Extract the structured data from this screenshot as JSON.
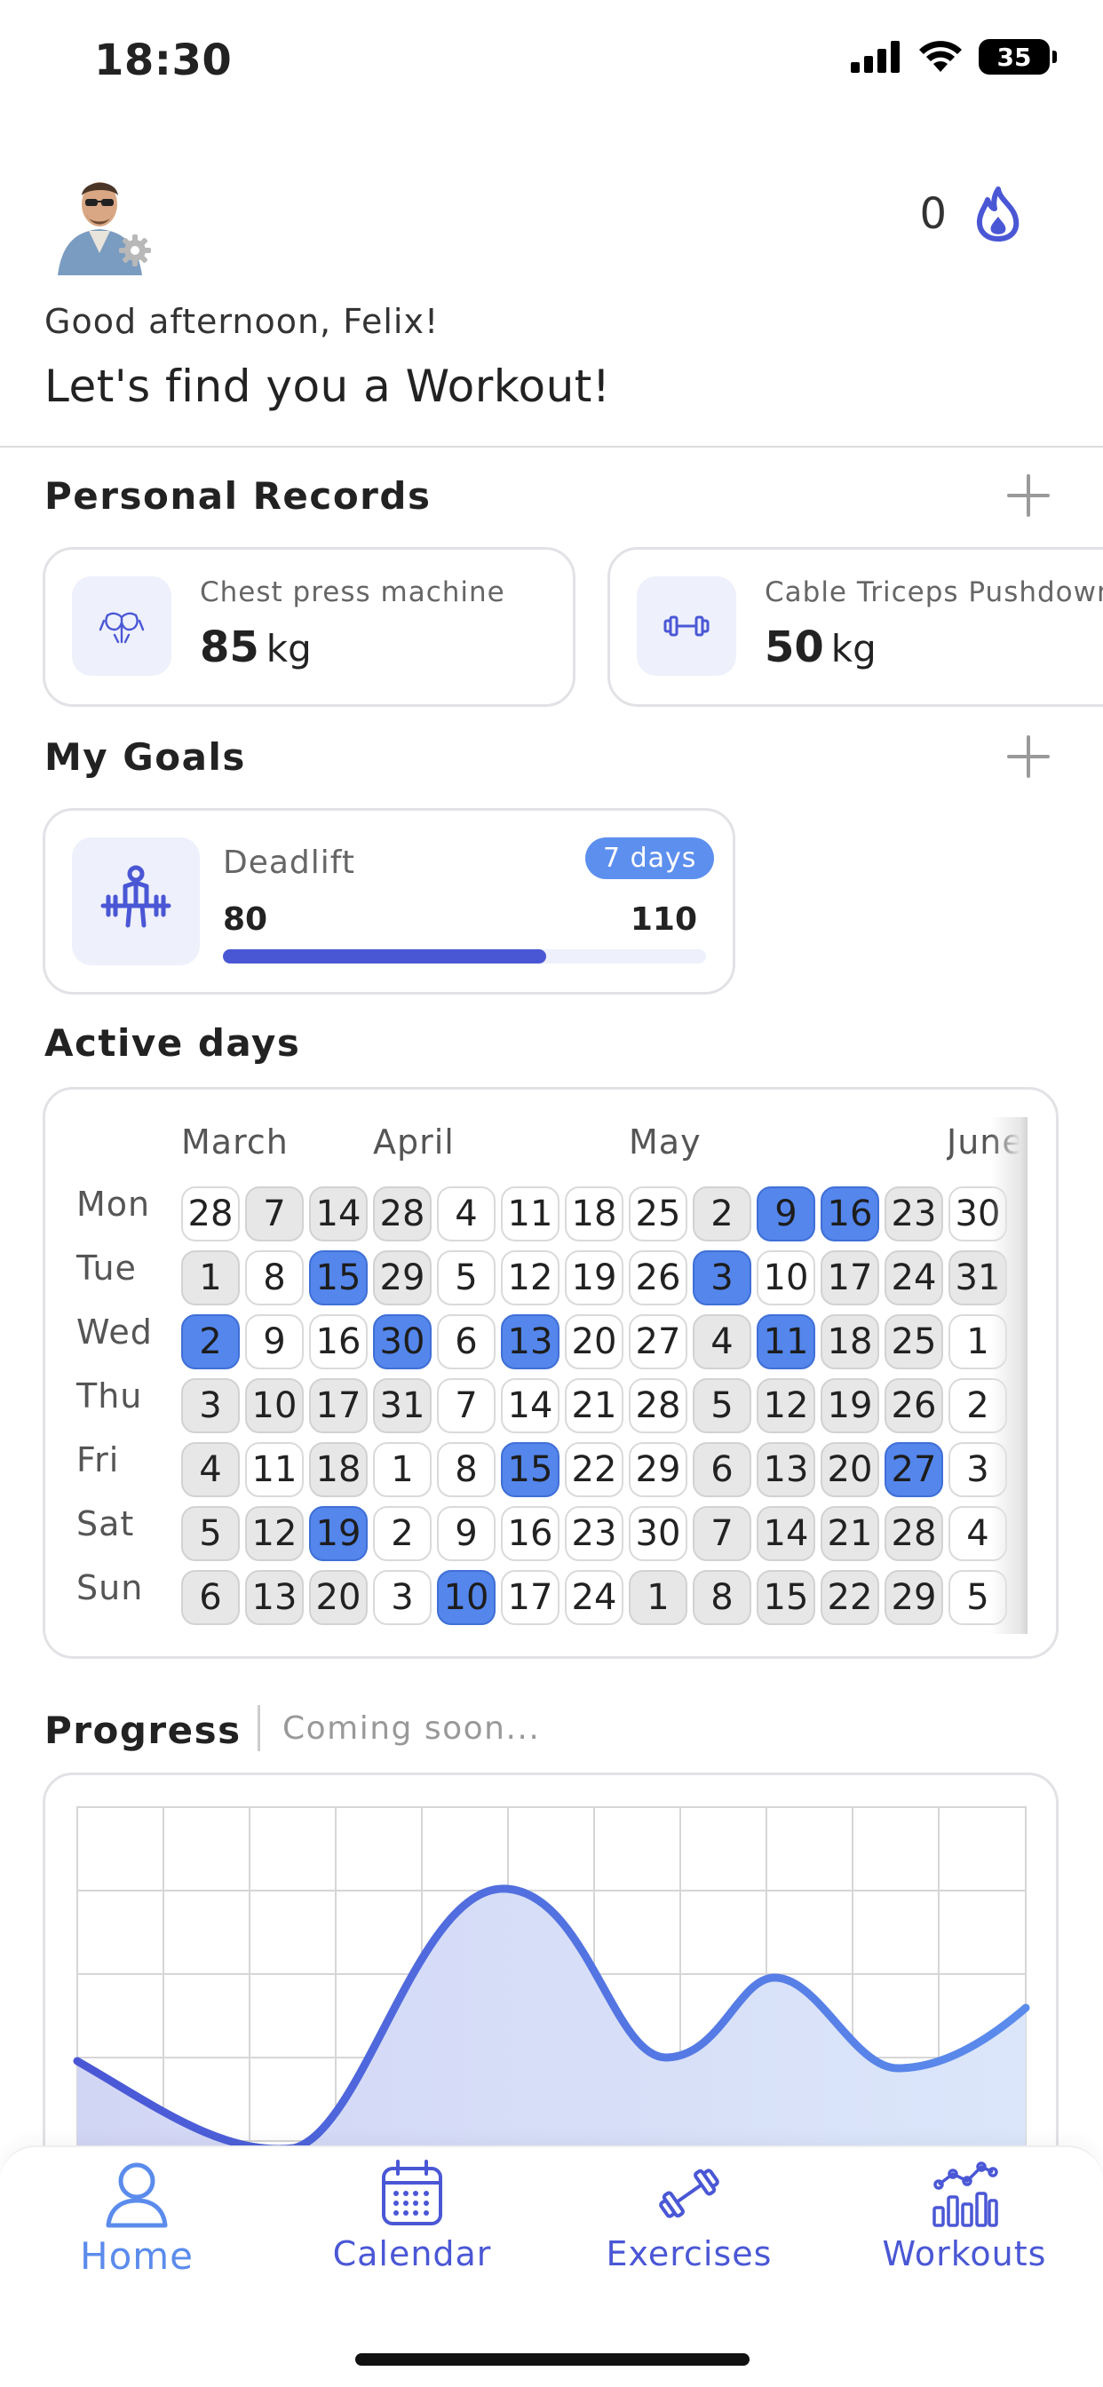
{
  "status": {
    "time": "18:30",
    "battery": "35"
  },
  "header": {
    "streak_count": "0",
    "greeting": "Good afternoon, Felix!",
    "headline": "Let's find you a Workout!"
  },
  "personal_records": {
    "title": "Personal Records",
    "items": [
      {
        "name": "Chest press machine",
        "value": "85",
        "unit": "kg",
        "icon": "chest-muscle-icon"
      },
      {
        "name": "Cable Triceps Pushdown",
        "value": "50",
        "unit": "kg",
        "icon": "dumbbell-icon"
      }
    ]
  },
  "goals": {
    "title": "My Goals",
    "items": [
      {
        "name": "Deadlift",
        "badge": "7 days",
        "start": "80",
        "target": "110",
        "progress": 0.67,
        "icon": "barbell-lift-icon"
      }
    ]
  },
  "active_days": {
    "title": "Active days",
    "months": [
      "March",
      "April",
      "May",
      "June"
    ],
    "weekdays": [
      "Mon",
      "Tue",
      "Wed",
      "Thu",
      "Fri",
      "Sat",
      "Sun"
    ],
    "weeks": [
      [
        {
          "d": "28",
          "s": "white"
        },
        {
          "d": "1",
          "s": "gray"
        },
        {
          "d": "2",
          "s": "blue"
        },
        {
          "d": "3",
          "s": "gray"
        },
        {
          "d": "4",
          "s": "gray"
        },
        {
          "d": "5",
          "s": "gray"
        },
        {
          "d": "6",
          "s": "gray"
        }
      ],
      [
        {
          "d": "7",
          "s": "gray"
        },
        {
          "d": "8",
          "s": "white"
        },
        {
          "d": "9",
          "s": "white"
        },
        {
          "d": "10",
          "s": "gray"
        },
        {
          "d": "11",
          "s": "white"
        },
        {
          "d": "12",
          "s": "gray"
        },
        {
          "d": "13",
          "s": "gray"
        }
      ],
      [
        {
          "d": "14",
          "s": "gray"
        },
        {
          "d": "15",
          "s": "blue"
        },
        {
          "d": "16",
          "s": "white"
        },
        {
          "d": "17",
          "s": "gray"
        },
        {
          "d": "18",
          "s": "gray"
        },
        {
          "d": "19",
          "s": "blue"
        },
        {
          "d": "20",
          "s": "gray"
        }
      ],
      [
        {
          "d": "28",
          "s": "gray"
        },
        {
          "d": "29",
          "s": "gray"
        },
        {
          "d": "30",
          "s": "blue"
        },
        {
          "d": "31",
          "s": "gray"
        },
        {
          "d": "1",
          "s": "white"
        },
        {
          "d": "2",
          "s": "white"
        },
        {
          "d": "3",
          "s": "white"
        }
      ],
      [
        {
          "d": "4",
          "s": "white"
        },
        {
          "d": "5",
          "s": "white"
        },
        {
          "d": "6",
          "s": "white"
        },
        {
          "d": "7",
          "s": "white"
        },
        {
          "d": "8",
          "s": "white"
        },
        {
          "d": "9",
          "s": "white"
        },
        {
          "d": "10",
          "s": "blue"
        }
      ],
      [
        {
          "d": "11",
          "s": "white"
        },
        {
          "d": "12",
          "s": "white"
        },
        {
          "d": "13",
          "s": "blue"
        },
        {
          "d": "14",
          "s": "white"
        },
        {
          "d": "15",
          "s": "blue"
        },
        {
          "d": "16",
          "s": "white"
        },
        {
          "d": "17",
          "s": "white"
        }
      ],
      [
        {
          "d": "18",
          "s": "white"
        },
        {
          "d": "19",
          "s": "white"
        },
        {
          "d": "20",
          "s": "white"
        },
        {
          "d": "21",
          "s": "white"
        },
        {
          "d": "22",
          "s": "white"
        },
        {
          "d": "23",
          "s": "white"
        },
        {
          "d": "24",
          "s": "white"
        }
      ],
      [
        {
          "d": "25",
          "s": "white"
        },
        {
          "d": "26",
          "s": "white"
        },
        {
          "d": "27",
          "s": "white"
        },
        {
          "d": "28",
          "s": "white"
        },
        {
          "d": "29",
          "s": "white"
        },
        {
          "d": "30",
          "s": "white"
        },
        {
          "d": "1",
          "s": "gray"
        }
      ],
      [
        {
          "d": "2",
          "s": "gray"
        },
        {
          "d": "3",
          "s": "blue"
        },
        {
          "d": "4",
          "s": "gray"
        },
        {
          "d": "5",
          "s": "gray"
        },
        {
          "d": "6",
          "s": "gray"
        },
        {
          "d": "7",
          "s": "gray"
        },
        {
          "d": "8",
          "s": "gray"
        }
      ],
      [
        {
          "d": "9",
          "s": "blue"
        },
        {
          "d": "10",
          "s": "white"
        },
        {
          "d": "11",
          "s": "blue"
        },
        {
          "d": "12",
          "s": "gray"
        },
        {
          "d": "13",
          "s": "gray"
        },
        {
          "d": "14",
          "s": "gray"
        },
        {
          "d": "15",
          "s": "gray"
        }
      ],
      [
        {
          "d": "16",
          "s": "blue"
        },
        {
          "d": "17",
          "s": "gray"
        },
        {
          "d": "18",
          "s": "gray"
        },
        {
          "d": "19",
          "s": "gray"
        },
        {
          "d": "20",
          "s": "gray"
        },
        {
          "d": "21",
          "s": "gray"
        },
        {
          "d": "22",
          "s": "gray"
        }
      ],
      [
        {
          "d": "23",
          "s": "gray"
        },
        {
          "d": "24",
          "s": "gray"
        },
        {
          "d": "25",
          "s": "gray"
        },
        {
          "d": "26",
          "s": "gray"
        },
        {
          "d": "27",
          "s": "blue"
        },
        {
          "d": "28",
          "s": "gray"
        },
        {
          "d": "29",
          "s": "gray"
        }
      ],
      [
        {
          "d": "30",
          "s": "white"
        },
        {
          "d": "31",
          "s": "gray"
        },
        {
          "d": "1",
          "s": "white"
        },
        {
          "d": "2",
          "s": "white"
        },
        {
          "d": "3",
          "s": "white"
        },
        {
          "d": "4",
          "s": "white"
        },
        {
          "d": "5",
          "s": "white"
        }
      ]
    ]
  },
  "progress": {
    "title": "Progress",
    "subtitle": "Coming soon..."
  },
  "nav": {
    "items": [
      {
        "label": "Home",
        "icon": "person-icon",
        "active": true
      },
      {
        "label": "Calendar",
        "icon": "calendar-icon",
        "active": false
      },
      {
        "label": "Exercises",
        "icon": "dumbbell-icon",
        "active": false
      },
      {
        "label": "Workouts",
        "icon": "stats-chart-icon",
        "active": false
      }
    ]
  },
  "colors": {
    "accent": "#4a57d5",
    "active_blue": "#5486ec",
    "tile_bg": "#eef0fb"
  }
}
